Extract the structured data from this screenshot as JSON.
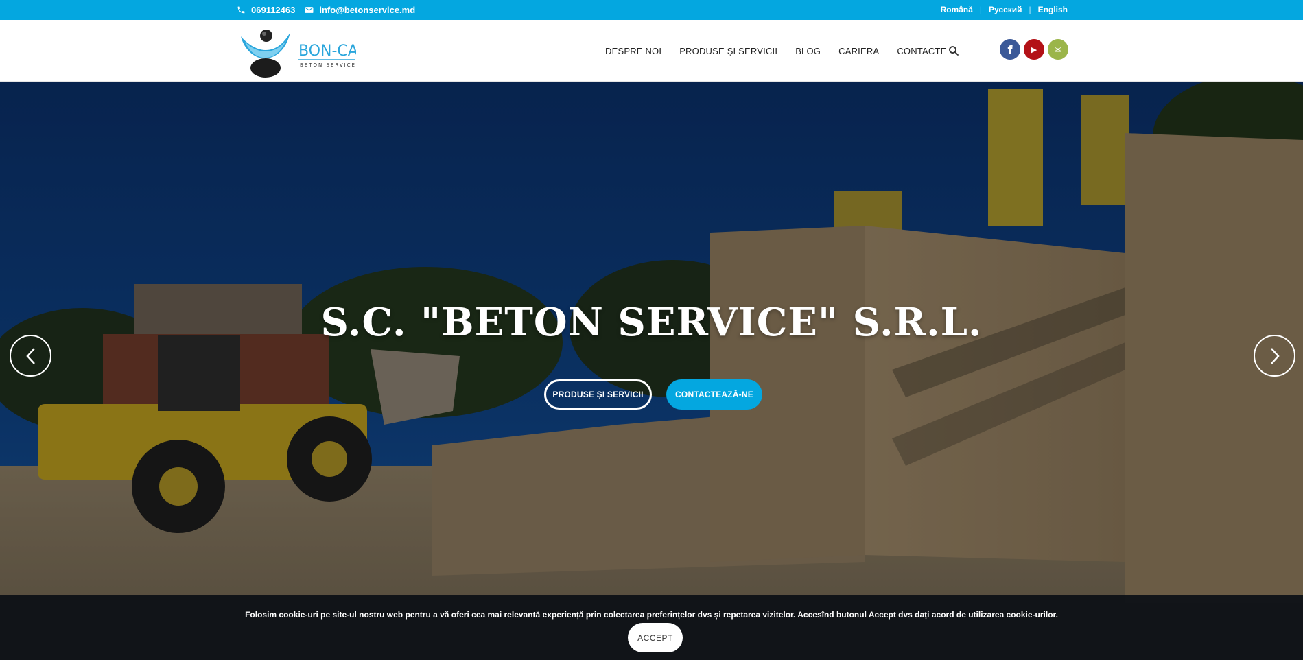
{
  "topbar": {
    "phone": "069112463",
    "email": "info@betonservice.md",
    "languages": [
      "Română",
      "Русский",
      "English"
    ]
  },
  "header": {
    "logo": {
      "brand": "BON-CAS",
      "tagline": "BETON SERVICE"
    },
    "nav": [
      "DESPRE NOI",
      "PRODUSE ȘI SERVICII",
      "BLOG",
      "CARIERA",
      "CONTACTE"
    ],
    "social": [
      {
        "name": "facebook-icon",
        "glyph": "f",
        "color": "#3b5998"
      },
      {
        "name": "youtube-icon",
        "glyph": "▶",
        "color": "#b31217"
      },
      {
        "name": "mail-icon",
        "glyph": "✉",
        "color": "#9bb54a"
      }
    ]
  },
  "hero": {
    "title": "S.C. \"BETON SERVICE\" S.R.L.",
    "button_primary": "PRODUSE ȘI SERVICII",
    "button_secondary": "CONTACTEAZĂ-NE",
    "accent_color": "#04a7e0"
  },
  "cookie": {
    "text": "Folosim cookie-uri pe site-ul nostru web pentru a vă oferi cea mai relevantă experiență prin colectarea preferințelor dvs și repetarea vizitelor. Accesînd butonul Accept dvs dați acord de utilizarea cookie-urilor.",
    "accept_label": "ACCEPT"
  }
}
